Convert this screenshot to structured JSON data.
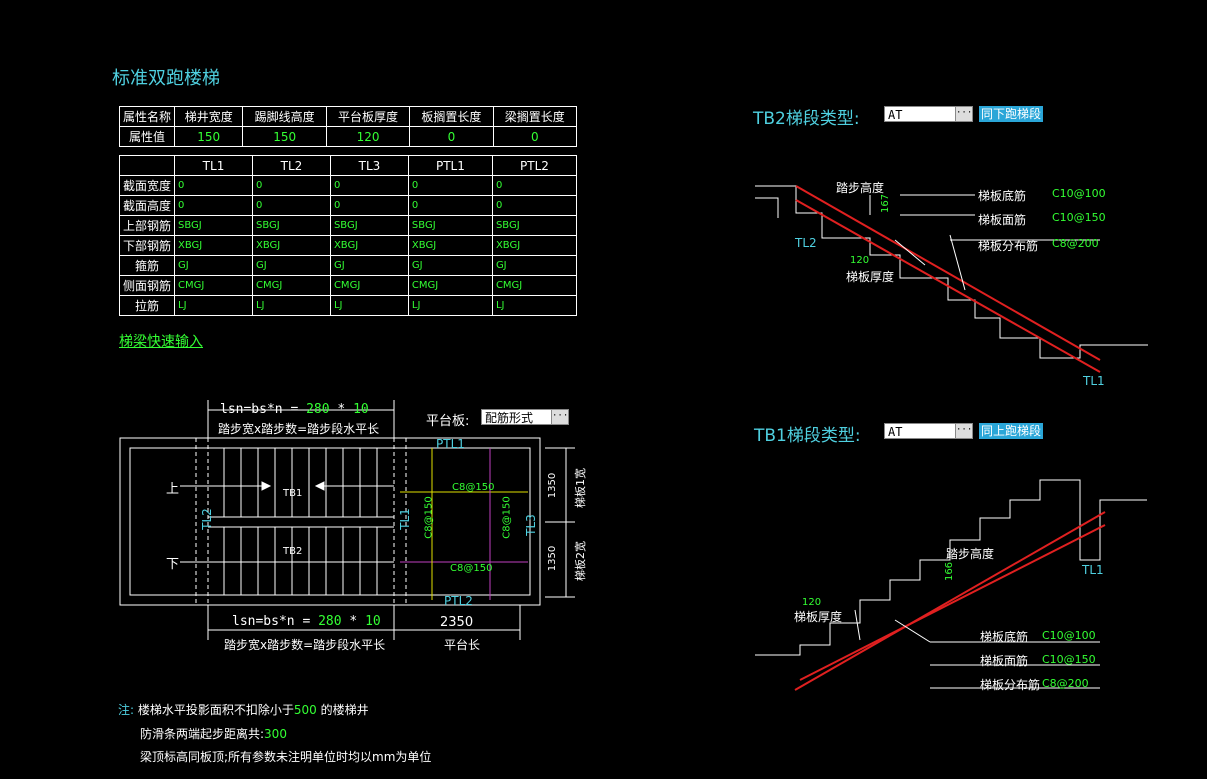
{
  "title": "标准双跑楼梯",
  "props_table": {
    "headers": [
      "属性名称",
      "梯井宽度",
      "踢脚线高度",
      "平台板厚度",
      "板搁置长度",
      "梁搁置长度"
    ],
    "row_label": "属性值",
    "values": [
      "150",
      "150",
      "120",
      "0",
      "0"
    ]
  },
  "beam_table": {
    "columns": [
      "TL1",
      "TL2",
      "TL3",
      "PTL1",
      "PTL2"
    ],
    "rows": [
      {
        "label": "截面宽度",
        "values": [
          "0",
          "0",
          "0",
          "0",
          "0"
        ]
      },
      {
        "label": "截面高度",
        "values": [
          "0",
          "0",
          "0",
          "0",
          "0"
        ]
      },
      {
        "label": "上部钢筋",
        "values": [
          "SBGJ",
          "SBGJ",
          "SBGJ",
          "SBGJ",
          "SBGJ"
        ]
      },
      {
        "label": "下部钢筋",
        "values": [
          "XBGJ",
          "XBGJ",
          "XBGJ",
          "XBGJ",
          "XBGJ"
        ]
      },
      {
        "label": "箍筋",
        "values": [
          "GJ",
          "GJ",
          "GJ",
          "GJ",
          "GJ"
        ]
      },
      {
        "label": "侧面钢筋",
        "values": [
          "CMGJ",
          "CMGJ",
          "CMGJ",
          "CMGJ",
          "CMGJ"
        ]
      },
      {
        "label": "拉筋",
        "values": [
          "LJ",
          "LJ",
          "LJ",
          "LJ",
          "LJ"
        ]
      }
    ]
  },
  "quick_input_link": "梯梁快速输入",
  "plan": {
    "formula_top_prefix": "lsn=bs*n = ",
    "formula_top_b": "280",
    "formula_top_star": " * ",
    "formula_top_n": "10",
    "formula_caption_top": "踏步宽x踏步数=踏步段水平长",
    "formula_bottom_prefix": "lsn=bs*n = ",
    "formula_bottom_b": "280",
    "formula_bottom_star": " * ",
    "formula_bottom_n": "10",
    "formula_caption_bottom": "踏步宽x踏步数=踏步段水平长",
    "platform_label": "平台板:",
    "platform_combo": "配筋形式",
    "up": "上",
    "down": "下",
    "tb1": "TB1",
    "tb2": "TB2",
    "tl1": "TL1",
    "tl2": "TL2",
    "tl3": "TL3",
    "ptl1": "PTL1",
    "ptl2": "PTL2",
    "rebar_c8_150_a": "C8@150",
    "rebar_c8_150_b": "C8@150",
    "rebar_c8_150_c": "C8@150",
    "rebar_c8_150_d": "C8@150",
    "width1": "1350",
    "width2": "1350",
    "width1_label": "梯板1宽",
    "width2_label": "梯板2宽",
    "platform_len": "2350",
    "platform_len_label": "平台长"
  },
  "tb2": {
    "label": "TB2梯段类型:",
    "combo": "AT",
    "button": "同下跑梯段",
    "step_height_label": "踏步高度",
    "step_height": "167",
    "thickness": "120",
    "thickness_label": "梯板厚度",
    "bottom_rebar_label": "梯板底筋",
    "bottom_rebar": "C10@100",
    "top_rebar_label": "梯板面筋",
    "top_rebar": "C10@150",
    "dist_rebar_label": "梯板分布筋",
    "dist_rebar": "C8@200",
    "tl_left": "TL2",
    "tl_right": "TL1"
  },
  "tb1": {
    "label": "TB1梯段类型:",
    "combo": "AT",
    "button": "同上跑梯段",
    "step_height_label": "踏步高度",
    "step_height": "166",
    "thickness": "120",
    "thickness_label": "梯板厚度",
    "bottom_rebar_label": "梯板底筋",
    "bottom_rebar": "C10@100",
    "top_rebar_label": "梯板面筋",
    "top_rebar": "C10@150",
    "dist_rebar_label": "梯板分布筋",
    "dist_rebar": "C8@200",
    "tl_right": "TL1"
  },
  "notes": {
    "prefix": "注:",
    "line1_a": "楼梯水平投影面积不扣除小于",
    "line1_v": "500",
    "line1_b": " 的楼梯井",
    "line2_a": "防滑条两端起步距离共:",
    "line2_v": "300",
    "line3": "梁顶标高同板顶;所有参数未注明单位时均以mm为单位"
  },
  "colors": {
    "cyan": "#4fd0e0",
    "green": "#33ff33",
    "red": "#e02020",
    "magenta": "#c040c0",
    "yellow": "#e0e000"
  }
}
